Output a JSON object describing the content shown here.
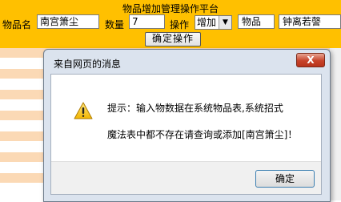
{
  "panel": {
    "title": "物品增加管理操作平台",
    "item_name_label": "物品名",
    "item_name_value": "南宫箫尘",
    "quantity_label": "数量",
    "quantity_value": "7",
    "operation_label": "操作",
    "operation_selected": "增加",
    "item_label": "物品",
    "item_value": "钟离若謦",
    "confirm_button": "确定操作"
  },
  "dialog": {
    "title": "来自网页的消息",
    "close_symbol": "X",
    "message_line1": "提示：输入物数据在系统物品表,系统招式",
    "message_line2": "魔法表中都不存在请查询或添加[南宫箫尘]！",
    "ok_button": "确定"
  },
  "colors": {
    "panel_bg": "#ffc000",
    "row_peach": "#fbd9b5",
    "dialog_frame": "#dbe3ee",
    "close_red": "#c7432a"
  }
}
